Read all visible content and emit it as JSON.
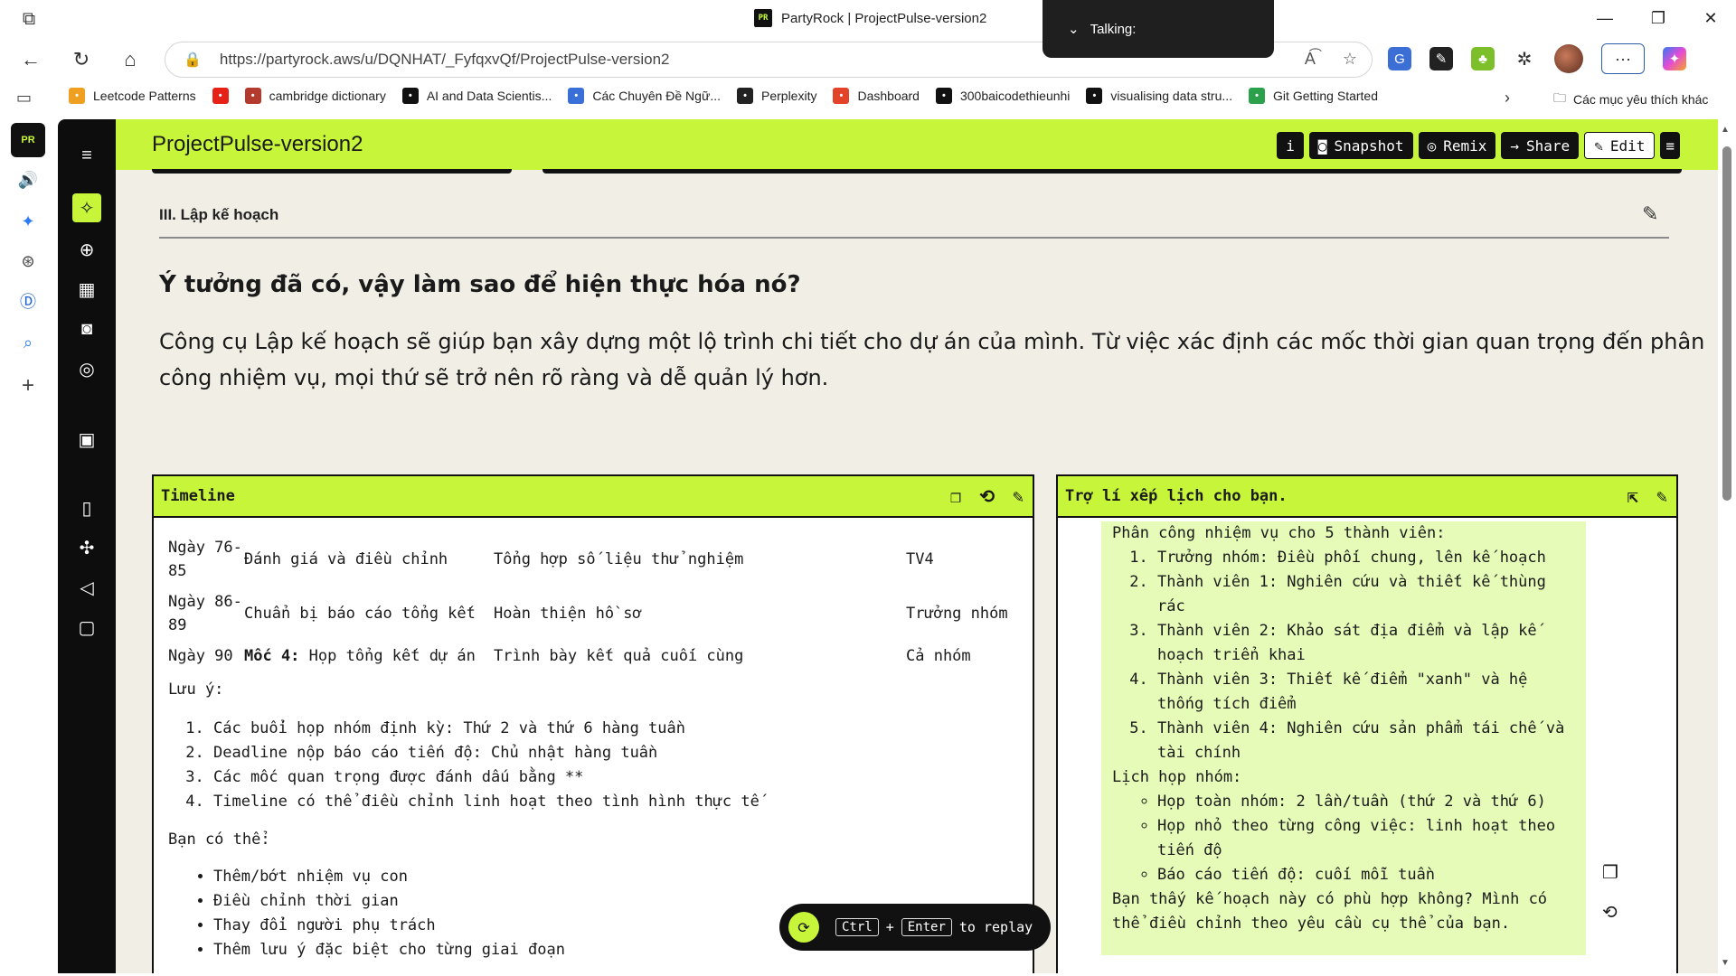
{
  "browser": {
    "tab_title": "PartyRock | ProjectPulse-version2",
    "url": "https://partyrock.aws/u/DQNHAT/_FyfqxvQf/ProjectPulse-version2",
    "talking_label": "Talking:",
    "favicon_text": "PR"
  },
  "bookmarks": [
    {
      "label": "Leetcode Patterns",
      "icon": "leetcode-icon",
      "color": "#f0a020"
    },
    {
      "label": "",
      "icon": "youtube-icon",
      "color": "#e62117"
    },
    {
      "label": "cambridge dictionary",
      "icon": "cambridge-icon",
      "color": "#b33a2c"
    },
    {
      "label": "AI and Data Scientis...",
      "icon": "ai-icon",
      "color": "#111111"
    },
    {
      "label": "Các Chuyên Đề Ngữ...",
      "icon": "globe-icon",
      "color": "#3a6fd8"
    },
    {
      "label": "Perplexity",
      "icon": "perplexity-icon",
      "color": "#222222"
    },
    {
      "label": "Dashboard",
      "icon": "gitlab-icon",
      "color": "#e24329"
    },
    {
      "label": "300baicodethieunhi",
      "icon": "github-icon",
      "color": "#111111"
    },
    {
      "label": "visualising data stru...",
      "icon": "visualgo-icon",
      "color": "#111111"
    },
    {
      "label": "Git Getting Started",
      "icon": "git-icon",
      "color": "#2aa14a"
    }
  ],
  "bookmarks_folder": "Các mục yêu thích khác",
  "app": {
    "title": "ProjectPulse-version2",
    "header_buttons": {
      "info": "i",
      "snapshot": "Snapshot",
      "remix": "Remix",
      "share": "Share",
      "edit": "Edit"
    },
    "section_label": "III. Lập kế hoạch",
    "heading": "Ý tưởng đã có, vậy làm sao để hiện thực hóa nó?",
    "intro": "Công cụ Lập kế hoạch sẽ giúp bạn xây dựng một lộ trình chi tiết cho dự án của mình. Từ việc xác định các mốc thời gian quan trọng đến phân công nhiệm vụ, mọi thứ sẽ trở nên rõ ràng và dễ quản lý hơn."
  },
  "timeline": {
    "title": "Timeline",
    "rows": [
      {
        "day": "Ngày 76-85",
        "milestone_bold": "",
        "phase": "Đánh giá và điều chỉnh",
        "task": "Tổng hợp số liệu thử nghiệm",
        "owner": "TV4"
      },
      {
        "day": "Ngày 86-89",
        "milestone_bold": "",
        "phase": "Chuẩn bị báo cáo tổng kết",
        "task": "Hoàn thiện hồ sơ",
        "owner": "Trưởng nhóm"
      },
      {
        "day": "Ngày 90",
        "milestone_bold": "Mốc 4:",
        "phase": "Họp tổng kết dự án",
        "task": "Trình bày kết quả cuối cùng",
        "owner": "Cả nhóm"
      }
    ],
    "note_title": "Lưu ý:",
    "notes": [
      "Các buổi họp nhóm định kỳ: Thứ 2 và thứ 6 hàng tuần",
      "Deadline nộp báo cáo tiến độ: Chủ nhật hàng tuần",
      "Các mốc quan trọng được đánh dấu bằng **",
      "Timeline có thể điều chỉnh linh hoạt theo tình hình thực tế"
    ],
    "can_title": "Bạn có thể:",
    "can_items": [
      "Thêm/bớt nhiệm vụ con",
      "Điều chỉnh thời gian",
      "Thay đổi người phụ trách",
      "Thêm lưu ý đặc biệt cho từng giai đoạn"
    ]
  },
  "assistant": {
    "title": "Trợ lí xếp lịch cho bạn.",
    "intro": "Phân công nhiệm vụ cho 5 thành viên:",
    "assignments": [
      "Trưởng nhóm: Điều phối chung, lên kế hoạch",
      "Thành viên 1: Nghiên cứu và thiết kế thùng rác",
      "Thành viên 2: Khảo sát địa điểm và lập kế hoạch triển khai",
      "Thành viên 3: Thiết kế điểm \"xanh\" và hệ thống tích điểm",
      "Thành viên 4: Nghiên cứu sản phẩm tái chế và tài chính"
    ],
    "meeting_title": "Lịch họp nhóm:",
    "meetings": [
      "Họp toàn nhóm: 2 lần/tuần (thứ 2 và thứ 6)",
      "Họp nhỏ theo từng công việc: linh hoạt theo tiến độ",
      "Báo cáo tiến độ: cuối mỗi tuần"
    ],
    "closing": "Bạn thấy kế hoạch này có phù hợp không? Mình có thể điều chỉnh theo yêu cầu cụ thể của bạn."
  },
  "replay": {
    "key1": "Ctrl",
    "plus": "+",
    "key2": "Enter",
    "label": "to replay"
  },
  "colors": {
    "accent": "#c6f53a",
    "rail": "#0d0d0d",
    "background": "#f1eee5",
    "assistant_bubble": "#e6fbb7"
  }
}
